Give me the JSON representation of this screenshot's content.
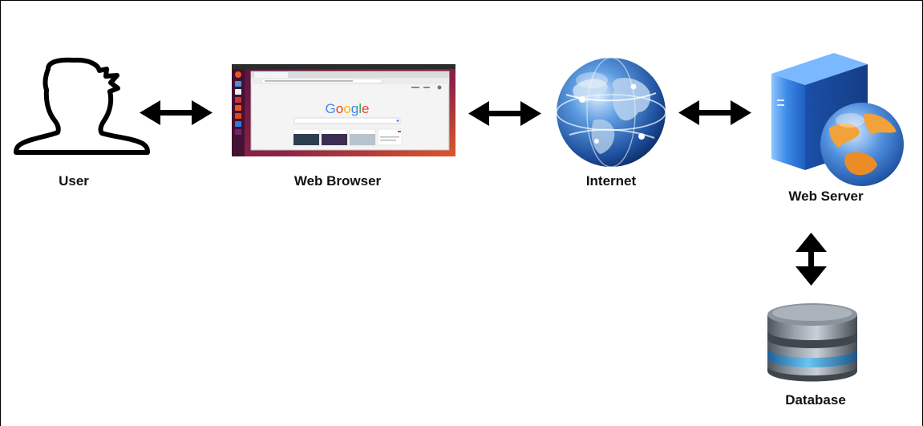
{
  "nodes": {
    "user": {
      "label": "User",
      "icon": "user-outline-icon"
    },
    "browser": {
      "label": "Web Browser",
      "icon": "browser-screenshot-icon",
      "screen": {
        "logo": "Google",
        "theme": "ubuntu"
      }
    },
    "internet": {
      "label": "Internet",
      "icon": "globe-icon"
    },
    "server": {
      "label": "Web Server",
      "icon": "server-icon"
    },
    "database": {
      "label": "Database",
      "icon": "database-icon"
    }
  },
  "connections": [
    {
      "from": "user",
      "to": "browser",
      "type": "bidirectional"
    },
    {
      "from": "browser",
      "to": "internet",
      "type": "bidirectional"
    },
    {
      "from": "internet",
      "to": "server",
      "type": "bidirectional"
    },
    {
      "from": "server",
      "to": "database",
      "type": "bidirectional"
    }
  ],
  "colors": {
    "arrow": "#000000",
    "browser_frame": "#6e1a3a",
    "ubuntu_orange": "#e95420",
    "google_blue": "#4285f4",
    "google_red": "#ea4335",
    "google_yellow": "#fbbc05",
    "google_green": "#34a853",
    "server_blue": "#2f7fe0",
    "globe_blue": "#2a64b8",
    "db_steel": "#6f7780",
    "db_band": "#3aa0dc"
  }
}
